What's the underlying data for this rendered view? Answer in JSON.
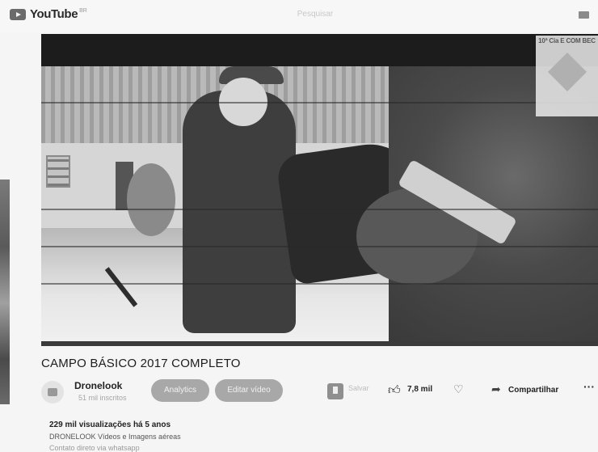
{
  "header": {
    "logo_text": "YouTube",
    "logo_suffix": "BR",
    "search_placeholder": "Pesquisar"
  },
  "video": {
    "overlay_text": "10ª Cia E COM BEC",
    "progress_fraction": 0.0
  },
  "meta": {
    "title": "CAMPO BÁSICO 2017 COMPLETO",
    "channel": "Dronelook",
    "subscribers": "51 mil inscritos",
    "analytics_label": "Analytics",
    "edit_label": "Editar vídeo",
    "save_extra": "Salvar",
    "like_count": "7,8 mil",
    "share_label": "Compartilhar",
    "more_label": "···"
  },
  "description": {
    "views_line": "229 mil visualizações  há 5 anos",
    "line1": "DRONELOOK Vídeos e Imagens aéreas",
    "line2": "Contato direto via whatsapp"
  },
  "icons": {
    "logo": "youtube-logo",
    "cast": "cast-icon",
    "save": "save-icon",
    "like": "thumbs-up-icon",
    "dislike": "thumbs-down-icon",
    "share": "share-arrow-icon",
    "more": "more-icon"
  }
}
